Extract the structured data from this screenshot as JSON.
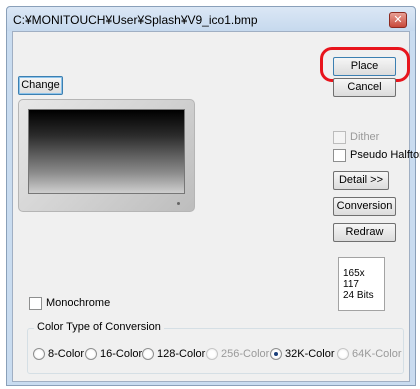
{
  "window": {
    "title": "C:¥MONITOUCH¥User¥Splash¥V9_ico1.bmp",
    "close_symbol": "✕"
  },
  "buttons": {
    "change": "Change",
    "place": "Place",
    "cancel": "Cancel",
    "detail": "Detail >>",
    "conversion": "Conversion",
    "redraw": "Redraw"
  },
  "checkboxes": {
    "dither": {
      "label": "Dither",
      "checked": false,
      "enabled": false
    },
    "pseudo_halftone": {
      "label": "Pseudo Halftone",
      "checked": false,
      "enabled": true
    },
    "monochrome": {
      "label": "Monochrome",
      "checked": false,
      "enabled": true
    }
  },
  "image_info": {
    "size": "165x 117",
    "bits": "24 Bits"
  },
  "color_type": {
    "title": "Color Type of Conversion",
    "options": [
      {
        "label": "8-Color",
        "enabled": true,
        "selected": false
      },
      {
        "label": "16-Color",
        "enabled": true,
        "selected": false
      },
      {
        "label": "128-Color",
        "enabled": true,
        "selected": false
      },
      {
        "label": "256-Color",
        "enabled": false,
        "selected": false
      },
      {
        "label": "32K-Color",
        "enabled": true,
        "selected": true
      },
      {
        "label": "64K-Color",
        "enabled": false,
        "selected": false
      }
    ]
  },
  "colors": {
    "highlight_ring": "#e8141c",
    "accent_border": "#3c7fb1"
  },
  "icons": {
    "close": "close-icon",
    "preview": "monitor-preview-image"
  }
}
